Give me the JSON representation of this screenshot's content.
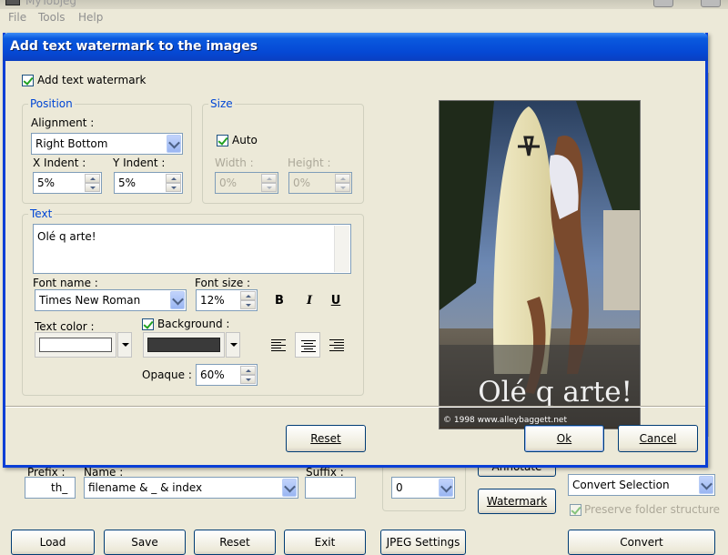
{
  "app": {
    "title": "MyTobjeg",
    "menu": [
      "File",
      "Tools",
      "Help"
    ]
  },
  "main_bottom": {
    "prefix_label": "Prefix :",
    "prefix_value": "th_",
    "name_label": "Name :",
    "name_value": "filename & _ & index",
    "suffix_label": "Suffix :",
    "suffix_value": "",
    "index_value": "0",
    "annotate_label": "Annotate",
    "watermark_label": "Watermark",
    "convert_selection": "Convert Selection",
    "preserve_label": "Preserve folder structure",
    "buttons": {
      "load": "Load",
      "save": "Save",
      "reset": "Reset",
      "exit": "Exit",
      "jpeg_settings": "JPEG Settings",
      "convert": "Convert"
    }
  },
  "dialog": {
    "title": "Add text watermark to the images",
    "add_watermark_label": "Add text watermark",
    "position": {
      "group": "Position",
      "alignment_label": "Alignment :",
      "alignment_value": "Right Bottom",
      "x_indent_label": "X Indent :",
      "x_indent_value": "5%",
      "y_indent_label": "Y Indent :",
      "y_indent_value": "5%"
    },
    "size": {
      "group": "Size",
      "auto_label": "Auto",
      "width_label": "Width :",
      "width_value": "0%",
      "height_label": "Height :",
      "height_value": "0%"
    },
    "text": {
      "group": "Text",
      "text_value": "Olé q arte!",
      "font_name_label": "Font name :",
      "font_name_value": "Times New Roman",
      "font_size_label": "Font size :",
      "font_size_value": "12%",
      "bold": "B",
      "italic": "I",
      "underline": "U",
      "text_color_label": "Text color :",
      "background_label": "Background :",
      "opaque_label": "Opaque :",
      "opaque_value": "60%"
    },
    "preview": {
      "overlay_text": "Olé q arte!",
      "copyright": "© 1998 www.alleybaggett.net"
    },
    "buttons": {
      "reset": "Reset",
      "ok": "Ok",
      "cancel": "Cancel"
    }
  },
  "colors": {
    "title_blue": "#0548d4",
    "group_title": "#0046d5",
    "text_color": "#ffffff",
    "background_color": "#3a3a3a"
  }
}
